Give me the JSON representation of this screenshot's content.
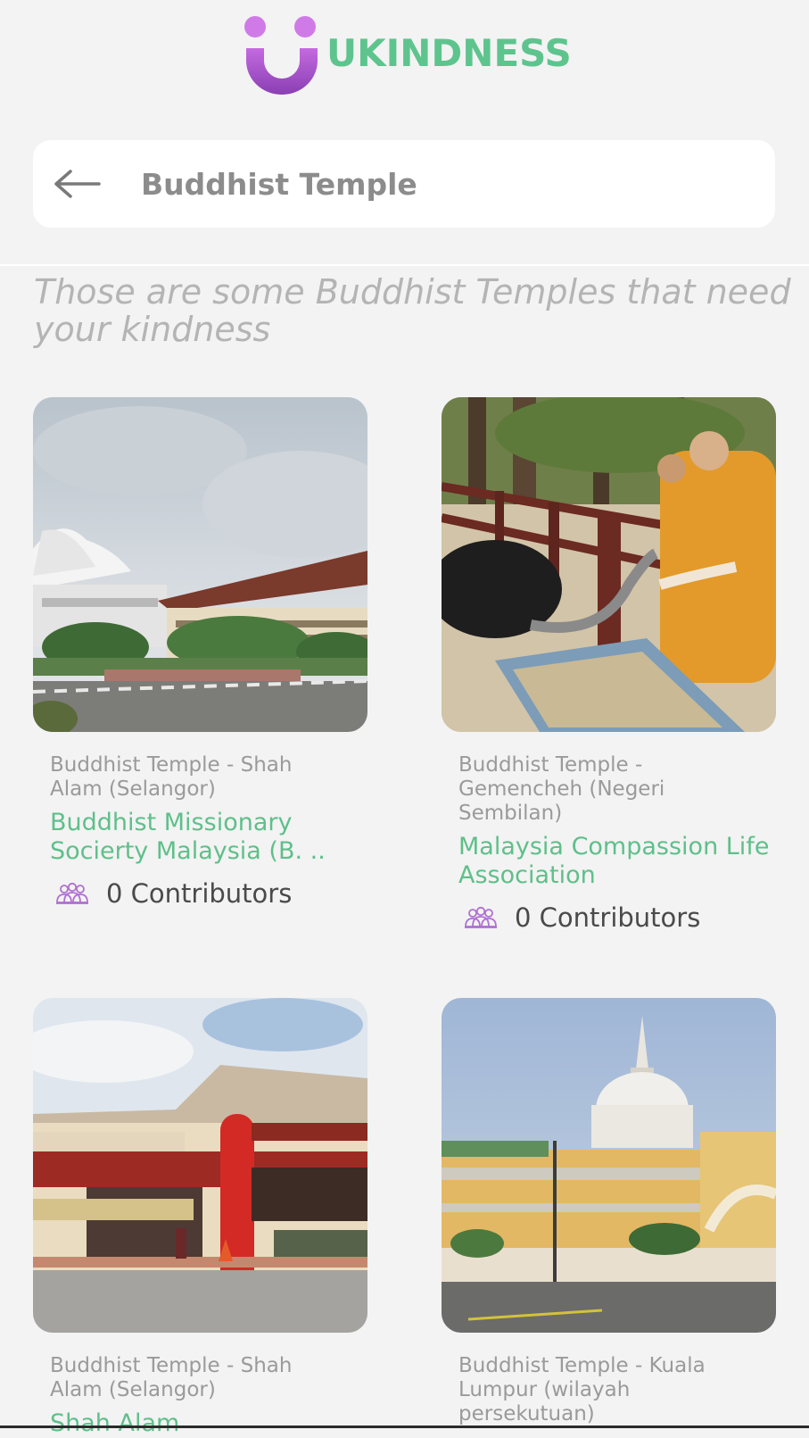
{
  "header": {
    "brand": "UKINDNESS",
    "colors": {
      "brand_text": "#5ec48e",
      "logo_purple": "#a050c8",
      "logo_light": "#cf7ae6"
    }
  },
  "search": {
    "query": "Buddhist Temple",
    "back_icon": "arrow-left-icon"
  },
  "intro_text": "Those are some Buddhist Temples that need your kindness",
  "cards": [
    {
      "location": "Buddhist Temple - Shah Alam (Selangor)",
      "title": "Buddhist Missionary Socierty Malaysia (B. ..",
      "contributors": "0 Contributors",
      "image": "lotus-building-photo"
    },
    {
      "location": "Buddhist Temple - Gemencheh (Negeri Sembilan)",
      "title": "Malaysia Compassion Life Association",
      "contributors": "0 Contributors",
      "image": "monk-feeding-ostrich-photo"
    },
    {
      "location": "Buddhist Temple - Shah Alam (Selangor)",
      "title": "Shah Alam",
      "contributors": "",
      "image": "temple-entrance-photo"
    },
    {
      "location": "Buddhist Temple - Kuala Lumpur (wilayah persekutuan)",
      "title": "",
      "contributors": "",
      "image": "white-stupa-temple-photo"
    }
  ],
  "contributors_icon": "people-group-icon",
  "colors": {
    "title_green": "#5fbf8a",
    "icon_purple": "#b070d0"
  }
}
